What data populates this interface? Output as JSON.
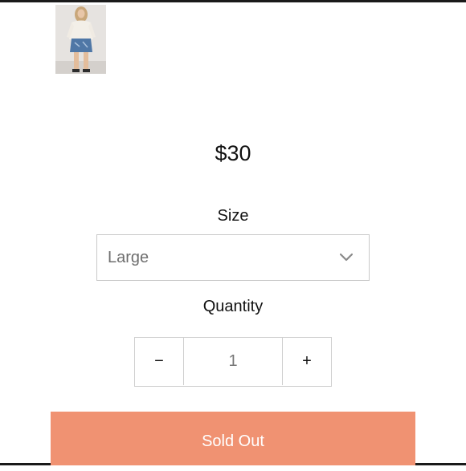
{
  "product": {
    "image_alt": "Product photo: model in white sweater and denim mini skirt",
    "price": "$30"
  },
  "size": {
    "label": "Size",
    "selected": "Large",
    "icon": "chevron-down-icon"
  },
  "quantity": {
    "label": "Quantity",
    "decrement": "−",
    "value": "1",
    "increment": "+"
  },
  "buy": {
    "label": "Sold Out",
    "color": "#f09272"
  }
}
